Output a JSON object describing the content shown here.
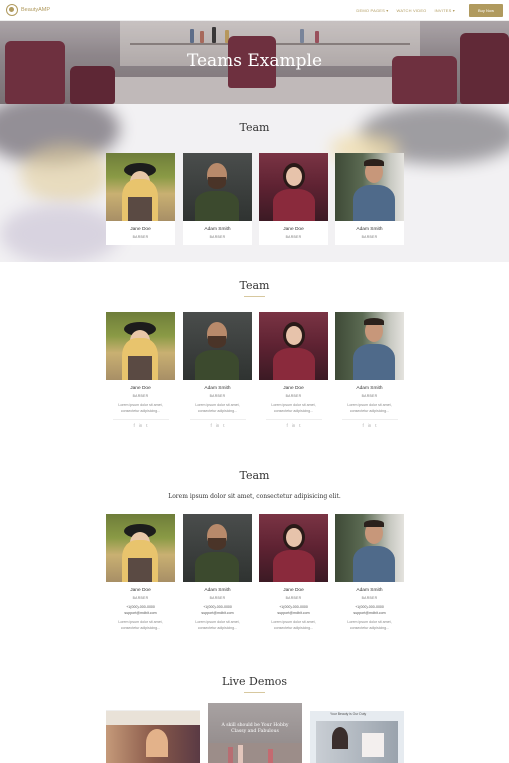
{
  "header": {
    "brand": "BeautyAMP",
    "nav": [
      "DEMO PAGES ▾",
      "WATCH VIDEO",
      "INVITES ▾"
    ],
    "buy_label": "Buy Now"
  },
  "hero": {
    "title": "Teams Example"
  },
  "section1": {
    "title": "Team",
    "members": [
      {
        "name": "Jane Doe",
        "role": "BARBER"
      },
      {
        "name": "Adam Smith",
        "role": "BARBER"
      },
      {
        "name": "Jane Doe",
        "role": "BARBER"
      },
      {
        "name": "Adam Smith",
        "role": "BARBER"
      }
    ]
  },
  "section2": {
    "title": "Team",
    "members": [
      {
        "name": "Jane Doe",
        "role": "BARBER",
        "desc1": "Lorem ipsum dolor sit amet,",
        "desc2": "consectetur adipisicing..."
      },
      {
        "name": "Adam Smith",
        "role": "BARBER",
        "desc1": "Lorem ipsum dolor sit amet,",
        "desc2": "consectetur adipisicing..."
      },
      {
        "name": "Jane Doe",
        "role": "BARBER",
        "desc1": "Lorem ipsum dolor sit amet,",
        "desc2": "consectetur adipisicing..."
      },
      {
        "name": "Adam Smith",
        "role": "BARBER",
        "desc1": "Lorem ipsum dolor sit amet,",
        "desc2": "consectetur adipisicing..."
      }
    ],
    "social": [
      "f",
      "in",
      "t"
    ]
  },
  "section3": {
    "title": "Team",
    "subtitle": "Lorem ipsum dolor sit amet, consectetur adipisicing elit.",
    "members": [
      {
        "name": "Jane Doe",
        "role": "BARBER",
        "phone": "+1(000)-000-0000",
        "email": "support@mdbit.com",
        "desc1": "Lorem ipsum dolor sit amet,",
        "desc2": "consectetur adipisicing..."
      },
      {
        "name": "Adam Smith",
        "role": "BARBER",
        "phone": "+1(000)-000-0000",
        "email": "support@mdbit.com",
        "desc1": "Lorem ipsum dolor sit amet,",
        "desc2": "consectetur adipisicing..."
      },
      {
        "name": "Jane Doe",
        "role": "BARBER",
        "phone": "+1(000)-000-0000",
        "email": "support@mdbit.com",
        "desc1": "Lorem ipsum dolor sit amet,",
        "desc2": "consectetur adipisicing..."
      },
      {
        "name": "Adam Smith",
        "role": "BARBER",
        "phone": "+1(000)-000-0000",
        "email": "support@mdbit.com",
        "desc1": "Lorem ipsum dolor sit amet,",
        "desc2": "consectetur adipisicing..."
      }
    ]
  },
  "demos": {
    "title": "Live Demos",
    "demo2_caption": "A skill should be Your Hobby Classy and Fabulous",
    "demo3_caption": "Your Beauty is Our Duty"
  },
  "colors": {
    "accent": "#b09a5e"
  }
}
